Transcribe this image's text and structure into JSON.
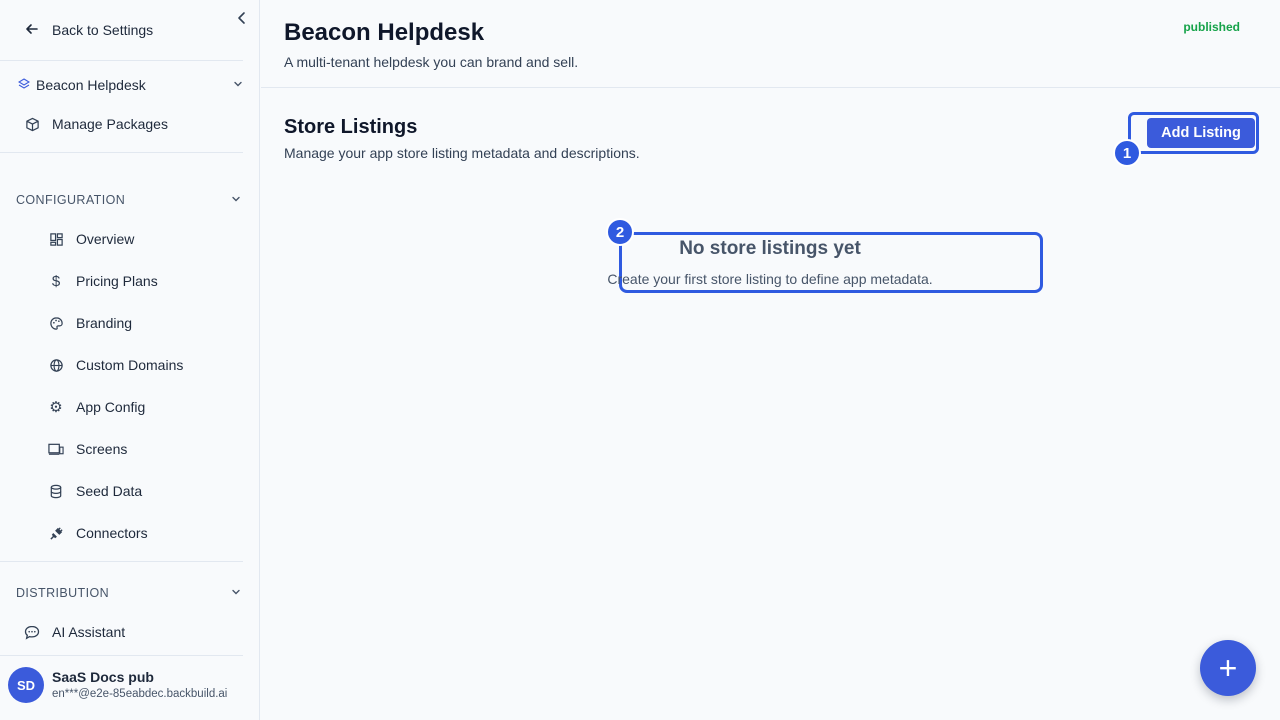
{
  "sidebar": {
    "back_label": "Back to Settings",
    "project_name": "Beacon Helpdesk",
    "manage_packages": "Manage Packages",
    "configuration_label": "CONFIGURATION",
    "config_items": [
      {
        "label": "Overview",
        "icon": "dashboard-icon"
      },
      {
        "label": "Pricing Plans",
        "icon": "dollar-icon"
      },
      {
        "label": "Branding",
        "icon": "palette-icon"
      },
      {
        "label": "Custom Domains",
        "icon": "globe-icon"
      },
      {
        "label": "App Config",
        "icon": "gear-icon"
      },
      {
        "label": "Screens",
        "icon": "screens-icon"
      },
      {
        "label": "Seed Data",
        "icon": "database-icon"
      },
      {
        "label": "Connectors",
        "icon": "plug-icon"
      }
    ],
    "distribution_label": "DISTRIBUTION",
    "ai_assistant": "AI Assistant",
    "user": {
      "initials": "SD",
      "name": "SaaS Docs pub",
      "email": "en***@e2e-85eabdec.backbuild.ai"
    }
  },
  "header": {
    "title": "Beacon Helpdesk",
    "subtitle": "A multi-tenant helpdesk you can brand and sell.",
    "status": "published"
  },
  "section": {
    "title": "Store Listings",
    "subtitle": "Manage your app store listing metadata and descriptions.",
    "add_button": "Add Listing"
  },
  "empty_state": {
    "title": "No store listings yet",
    "subtitle": "Create your first store listing to define app metadata."
  },
  "annotations": [
    "1",
    "2"
  ],
  "fab_label": "+",
  "colors": {
    "accent": "#3b5bdb",
    "status": "#16a34a",
    "highlight": "#2f5ae0"
  }
}
